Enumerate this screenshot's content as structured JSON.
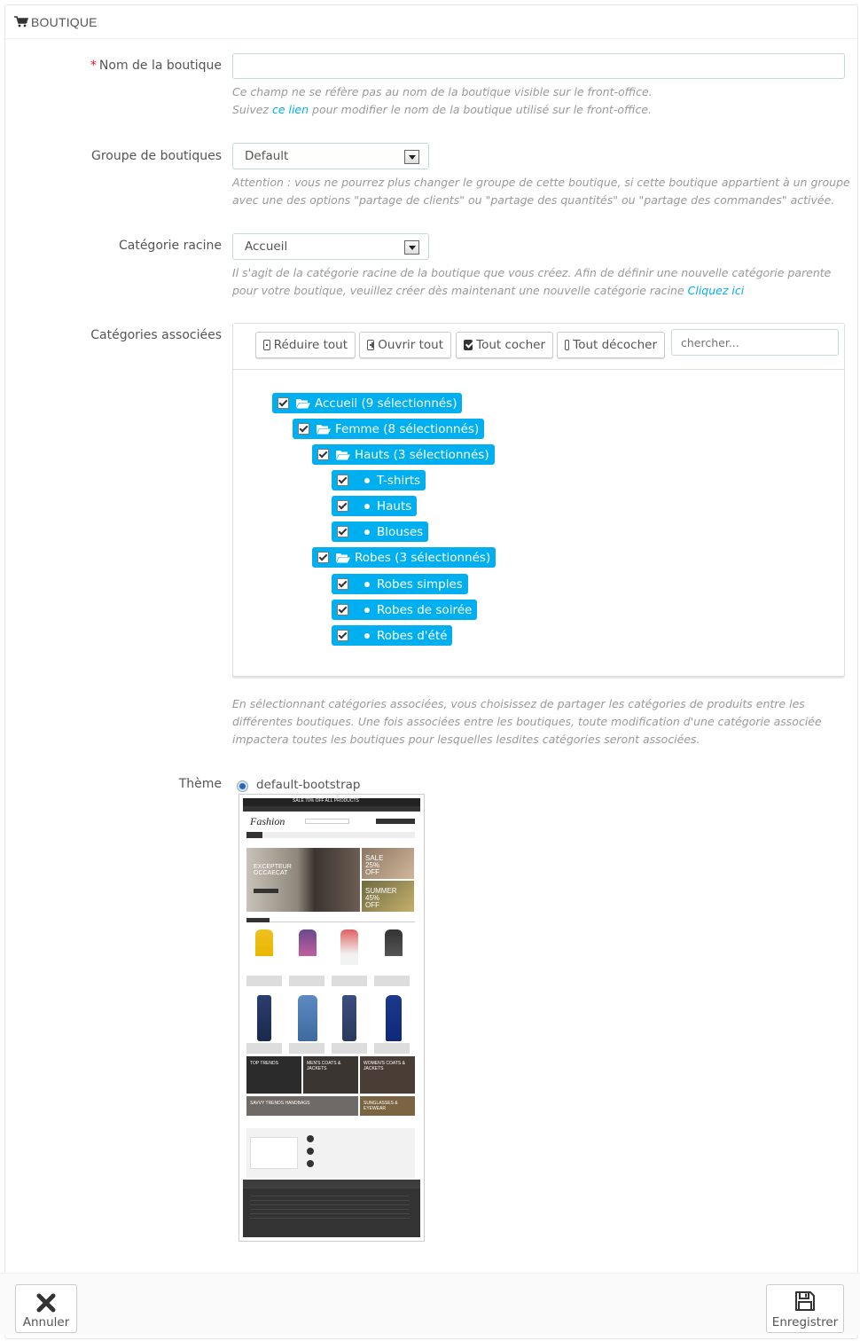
{
  "panel": {
    "title": "BOUTIQUE",
    "icon": "cart-icon"
  },
  "form": {
    "shop_name": {
      "label": "Nom de la boutique",
      "required_mark": "*",
      "value": "",
      "help_line1": "Ce champ ne se réfère pas au nom de la boutique visible sur le front-office.",
      "help_line2_prefix": "Suivez ",
      "help_line2_link": "ce lien",
      "help_line2_suffix": " pour modifier le nom de la boutique utilisé sur le front-office."
    },
    "shop_group": {
      "label": "Groupe de boutiques",
      "selected": "Default",
      "help_line1": "Attention : vous ne pourrez plus changer le groupe de cette boutique, si cette boutique appartient à un groupe",
      "help_line2": "avec une des options \"partage de clients\" ou \"partage des quantités\" ou \"partage des commandes\" activée."
    },
    "root_category": {
      "label": "Catégorie racine",
      "selected": "Accueil",
      "help_line1": "Il s'agit de la catégorie racine de la boutique que vous créez. Afin de définir une nouvelle catégorie parente",
      "help_line2_prefix": "pour votre boutique, veuillez créer dès maintenant une nouvelle catégorie racine ",
      "help_line2_link": "Cliquez ici"
    },
    "associated_categories": {
      "label": "Catégories associées",
      "toolbar": {
        "collapse_all": "Réduire tout",
        "expand_all": "Ouvrir tout",
        "check_all": "Tout cocher",
        "uncheck_all": "Tout décocher",
        "search_placeholder": "chercher..."
      },
      "tree": [
        {
          "label": "Accueil (9 sélectionnés)",
          "type": "folder",
          "checked": true
        },
        {
          "label": "Femme (8 sélectionnés)",
          "type": "folder",
          "checked": true
        },
        {
          "label": "Hauts (3 sélectionnés)",
          "type": "folder",
          "checked": true
        },
        {
          "label": "T-shirts",
          "type": "leaf",
          "checked": true
        },
        {
          "label": "Hauts",
          "type": "leaf",
          "checked": true
        },
        {
          "label": "Blouses",
          "type": "leaf",
          "checked": true
        },
        {
          "label": "Robes (3 sélectionnés)",
          "type": "folder",
          "checked": true
        },
        {
          "label": "Robes simples",
          "type": "leaf",
          "checked": true
        },
        {
          "label": "Robes de soirée",
          "type": "leaf",
          "checked": true
        },
        {
          "label": "Robes d'été",
          "type": "leaf",
          "checked": true
        }
      ],
      "help_line1": "En sélectionnant catégories associées, vous choisissez de partager les catégories de produits entre les",
      "help_line2": "différentes boutiques. Une fois associées entre les boutiques, toute modification d'une catégorie associée",
      "help_line3": "impactera toutes les boutiques pour lesquelles lesdites catégories seront associées."
    },
    "theme": {
      "label": "Thème",
      "option": "default-bootstrap",
      "selected": true,
      "preview": {
        "banner": "SALE 70% OFF ALL PRODUCTS",
        "logo": "Fashion",
        "hero_title": "EXCEPTEUR OCCAECAT",
        "promo_1": "SALE 25% OFF",
        "promo_2": "SUMMER 45% OFF",
        "tiles": [
          "TOP TRENDS",
          "MEN'S COATS & JACKETS",
          "WOMEN'S COATS & JACKETS",
          "SAVVY TRENDS HANDBAGS",
          "SUNGLASSES & EYEWEAR"
        ]
      }
    }
  },
  "footer": {
    "cancel_label": "Annuler",
    "save_label": "Enregistrer"
  },
  "colors": {
    "accent": "#00aff0",
    "border": "#c7d6db",
    "help_text": "#999999"
  }
}
